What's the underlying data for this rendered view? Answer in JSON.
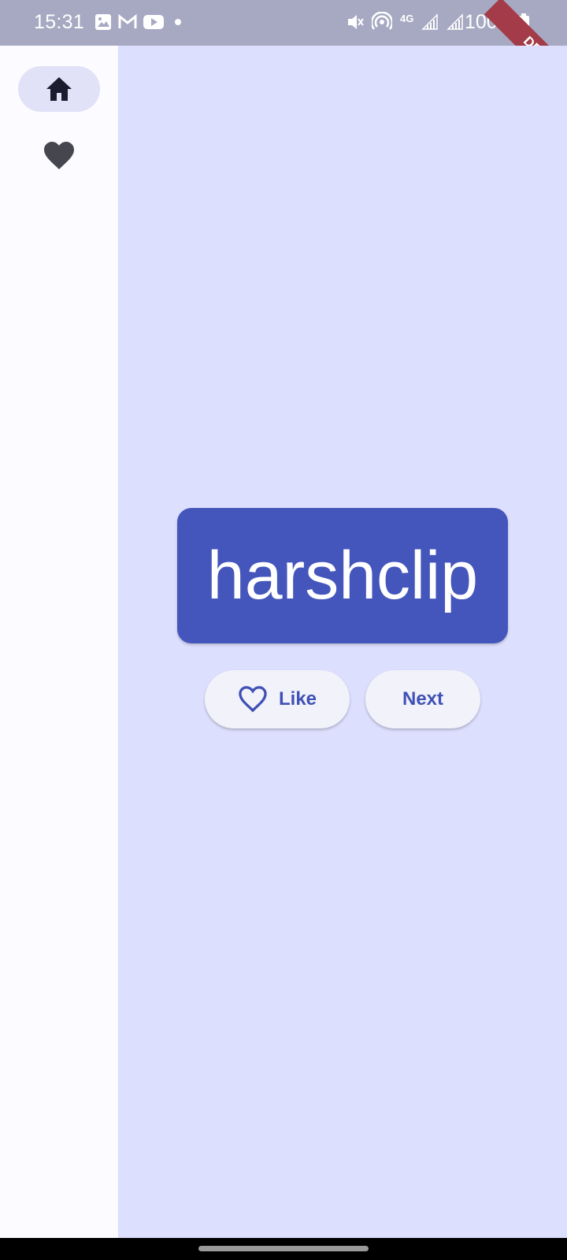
{
  "status_bar": {
    "time": "15:31",
    "battery_text": "100%",
    "network_label": "4G",
    "icons": [
      "gallery-icon",
      "gmail-icon",
      "youtube-icon",
      "dot-icon",
      "mute-icon",
      "hotspot-icon",
      "network-4g-icon",
      "signal-icon",
      "signal-icon",
      "battery-icon"
    ]
  },
  "debug_banner": {
    "label": "DEBUG"
  },
  "nav_rail": {
    "items": [
      {
        "name": "home",
        "icon": "home-icon",
        "selected": true
      },
      {
        "name": "favorites",
        "icon": "heart-icon",
        "selected": false
      }
    ]
  },
  "main": {
    "word": "harshclip",
    "like_label": "Like",
    "next_label": "Next"
  },
  "colors": {
    "background": "#dcdffd",
    "card": "#4456bb",
    "button_text": "#3f51b5",
    "rail": "#fcfbff",
    "rail_selected": "#e1e1f7"
  }
}
